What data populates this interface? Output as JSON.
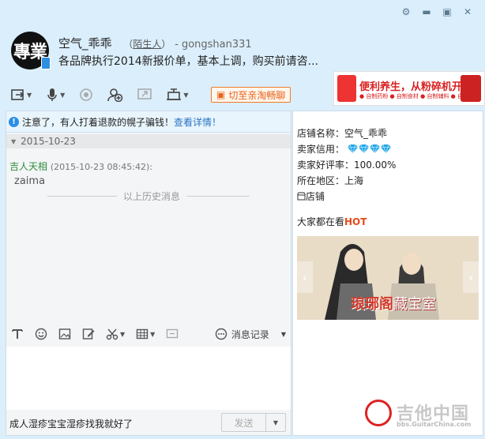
{
  "window": {
    "controls": [
      "gear-icon",
      "minimize-icon",
      "maximize-icon",
      "close-icon"
    ]
  },
  "contact": {
    "avatar_text": "專業",
    "name": "空气_乖乖",
    "stranger_tag": "陌生人",
    "account": "- gongshan331",
    "signature": "各品牌执行2014新报价单，基本上调，购买前请咨..."
  },
  "toolbar": {
    "items": [
      "file-send-icon",
      "microphone-icon",
      "camera-icon",
      "add-contact-icon",
      "screen-share-icon",
      "remote-assist-icon"
    ],
    "taobao_button": "切至亲淘畅聊"
  },
  "ad": {
    "title": "便利养生，从粉碎机开始",
    "subtitle": "● 自制药粉 ● 自制食材 ● 自制辅料 ● 自制药粉"
  },
  "chat": {
    "notice_text": "注意了，有人打着退款的幌子骗钱！",
    "notice_link": "查看详情！",
    "date": "2015-10-23",
    "message_sender": "吉人天相",
    "message_time": "(2015-10-23 08:45:42):",
    "message_text": "zaima",
    "history_label": "以上历史消息"
  },
  "input": {
    "tools": [
      "font-icon",
      "emoji-icon",
      "image-icon",
      "edit-icon",
      "scissors-icon",
      "table-icon",
      "screenshot-icon"
    ],
    "records_label": "消息记录",
    "draft_text": "成人湿疹宝宝湿疹找我就好了",
    "send_label": "发送"
  },
  "shop": {
    "name_label": "店铺名称：",
    "name_value": "空气_乖乖",
    "credit_label": "卖家信用：",
    "credit_diamonds": 4,
    "rating_label": "卖家好评率：",
    "rating_value": "100.00%",
    "location_label": "所在地区：",
    "location_value": "上海",
    "store_link": "店铺",
    "trending_label": "大家都在看",
    "trending_hot": "HOT",
    "banner_brand": "琅琊阁",
    "banner_sub": "藏宝室"
  },
  "watermark": {
    "title": "吉他中国",
    "url": "bbs.GuitarChina.com"
  },
  "colors": {
    "accent_orange": "#e8631a",
    "link_blue": "#2a73c4",
    "sender_green": "#2e8b3d",
    "hot_red": "#e24a1a",
    "diamond_blue": "#22a6e8"
  }
}
